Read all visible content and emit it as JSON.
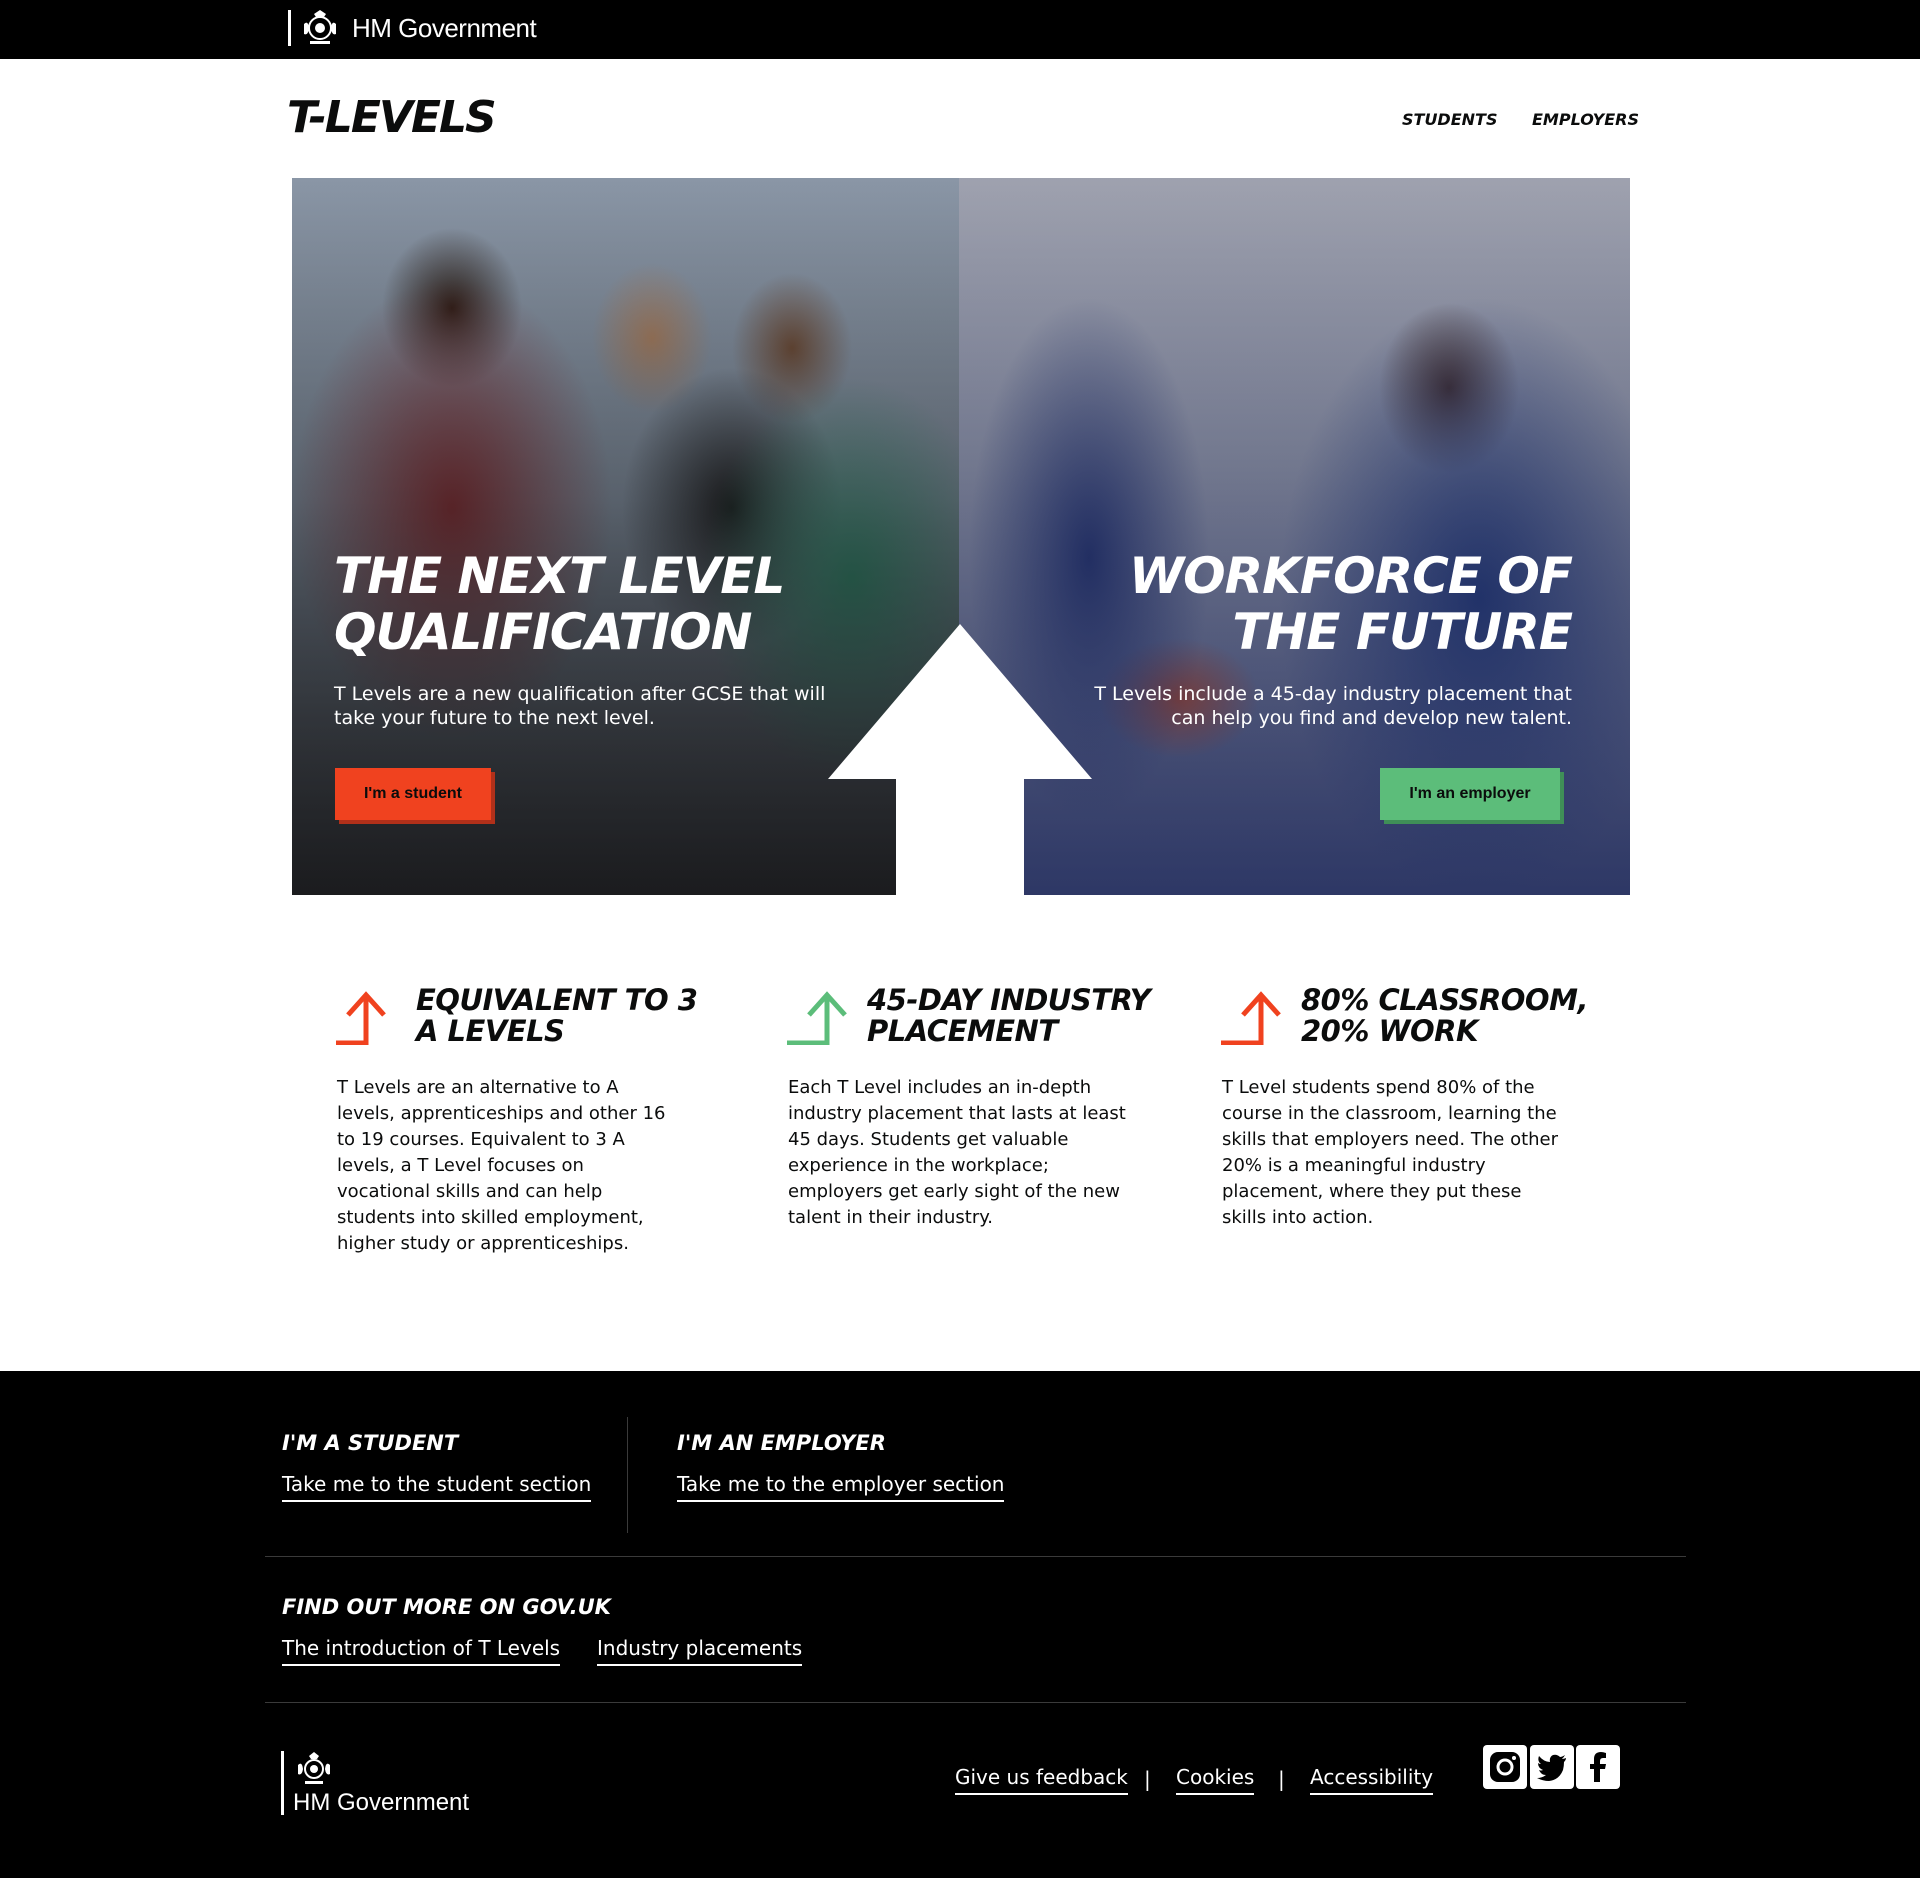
{
  "gov_bar": {
    "name": "HM Government"
  },
  "header": {
    "logo": "T-LEVELS",
    "nav": [
      "STUDENTS",
      "EMPLOYERS"
    ]
  },
  "hero": {
    "student": {
      "heading": "THE NEXT LEVEL QUALIFICATION",
      "text": "T Levels are a new qualification after GCSE that will take your future to the next level.",
      "button": "I'm a student"
    },
    "employer": {
      "heading": "WORKFORCE OF THE FUTURE",
      "text": "T Levels include a 45-day industry placement that can help you find and develop new talent.",
      "button": "I'm an employer"
    }
  },
  "features": [
    {
      "title": "EQUIVALENT TO 3 A LEVELS",
      "icon": "arrow-up-icon",
      "color": "#f0421f",
      "text": "T Levels are an alternative to A levels, apprenticeships and other 16 to 19 courses. Equivalent to 3 A levels, a T Level focuses on vocational skills and can help students into skilled employment, higher study or apprenticeships."
    },
    {
      "title": "45-DAY INDUSTRY PLACEMENT",
      "icon": "arrow-up-icon",
      "color": "#5cbd7a",
      "text": "Each T Level includes an in-depth industry placement that lasts at least 45 days. Students get valuable experience in the workplace; employers get early sight of the new talent in their industry."
    },
    {
      "title": "80% CLASSROOM, 20% WORK",
      "icon": "arrow-up-icon",
      "color": "#f0421f",
      "text": "T Level students spend 80% of the course in the classroom, learning the skills that employers need. The other 20% is a meaningful industry placement, where they put these skills into action."
    }
  ],
  "footer": {
    "student": {
      "heading": "I'M A STUDENT",
      "link": "Take me to the student section"
    },
    "employer": {
      "heading": "I'M AN EMPLOYER",
      "link": "Take me to the employer section"
    },
    "gov": {
      "heading": "FIND OUT MORE ON GOV.UK",
      "links": [
        "The introduction of T Levels",
        "Industry placements"
      ]
    },
    "gov_name": "HM Government",
    "bottom_links": [
      "Give us feedback",
      "Cookies",
      "Accessibility"
    ],
    "separator": "|",
    "social": [
      "instagram-icon",
      "twitter-icon",
      "facebook-icon"
    ]
  },
  "colors": {
    "student": "#f0421f",
    "employer": "#5cbd7a",
    "dark": "#000000"
  }
}
